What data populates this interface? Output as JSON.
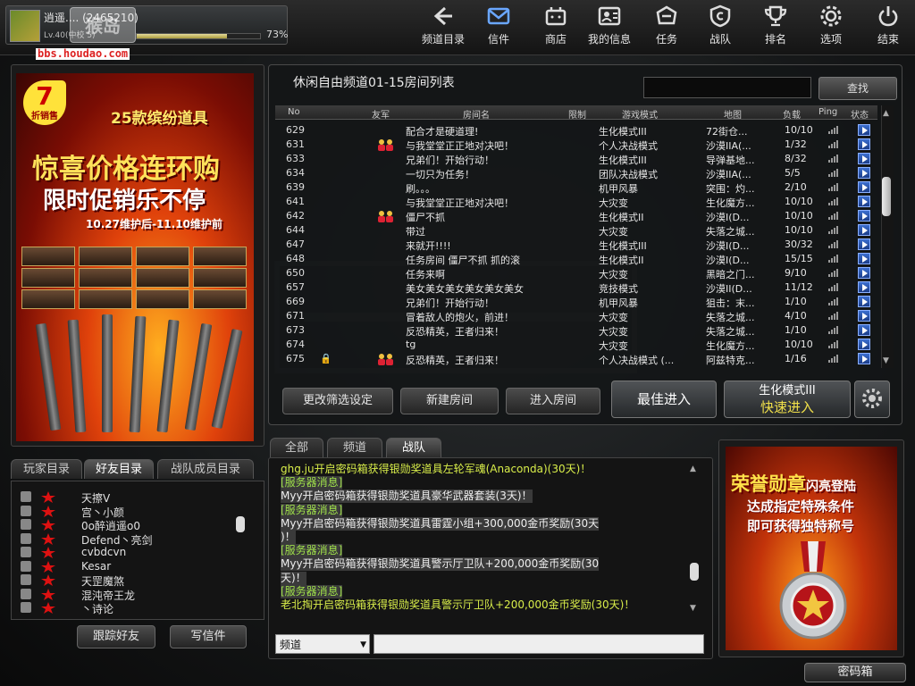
{
  "profile": {
    "name": "逍遥.... (2465210)",
    "level": "Lv.40(中校 5)",
    "xp_percent": "73%",
    "xp_fraction": 0.73
  },
  "watermark": {
    "url": "bbs.houdao.com",
    "logo": "猴岛"
  },
  "nav": [
    {
      "label": "频道目录",
      "icon": "back-arrow-icon"
    },
    {
      "label": "信件",
      "icon": "mail-icon"
    },
    {
      "label": "商店",
      "icon": "shop-icon"
    },
    {
      "label": "我的信息",
      "icon": "profile-card-icon"
    },
    {
      "label": "任务",
      "icon": "mission-icon"
    },
    {
      "label": "战队",
      "icon": "clan-shield-icon"
    },
    {
      "label": "排名",
      "icon": "trophy-icon"
    },
    {
      "label": "选项",
      "icon": "gear-icon"
    },
    {
      "label": "结束",
      "icon": "power-icon"
    }
  ],
  "ad_left": {
    "discount": "7",
    "discount_sub": "折销售",
    "line1": "25款缤纷道具",
    "line2": "惊喜价格连环购",
    "line3": "限时促销乐不停",
    "line4": "10.27维护后-11.10维护前"
  },
  "room_panel": {
    "title": "休闲自由频道01-15房间列表",
    "search_placeholder": "",
    "search_button": "查找",
    "columns": [
      "No",
      "友军",
      "房间名",
      "限制",
      "游戏模式",
      "地图",
      "负载",
      "Ping",
      "状态"
    ],
    "rows": [
      {
        "no": "629",
        "name": "配合才是硬道理!",
        "mode": "生化模式III",
        "map": "72街仓...",
        "load": "10/10",
        "friend": false,
        "lock": false
      },
      {
        "no": "631",
        "name": "与我堂堂正正地对决吧！",
        "mode": "个人决战模式",
        "map": "沙漠IIA(...",
        "load": "1/32",
        "friend": true,
        "lock": false
      },
      {
        "no": "633",
        "name": "兄弟们！开始行动！",
        "mode": "生化模式III",
        "map": "导弹基地...",
        "load": "8/32",
        "friend": false,
        "lock": false
      },
      {
        "no": "634",
        "name": "一切只为任务！",
        "mode": "团队决战模式",
        "map": "沙漠IIA(...",
        "load": "5/5",
        "friend": false,
        "lock": false
      },
      {
        "no": "639",
        "name": "刷。。。",
        "mode": "机甲风暴",
        "map": "突围：灼...",
        "load": "2/10",
        "friend": false,
        "lock": false
      },
      {
        "no": "641",
        "name": "与我堂堂正正地对决吧！",
        "mode": "大灾变",
        "map": "生化魔方...",
        "load": "10/10",
        "friend": false,
        "lock": false
      },
      {
        "no": "642",
        "name": "僵尸不抓",
        "mode": "生化模式II",
        "map": "沙漠I(D...",
        "load": "10/10",
        "friend": true,
        "lock": false
      },
      {
        "no": "644",
        "name": "带过",
        "mode": "大灾变",
        "map": "失落之城...",
        "load": "10/10",
        "friend": false,
        "lock": false
      },
      {
        "no": "647",
        "name": "来就开!!!!",
        "mode": "生化模式III",
        "map": "沙漠I(D...",
        "load": "30/32",
        "friend": false,
        "lock": false
      },
      {
        "no": "648",
        "name": "任务房间   僵尸不抓  抓的滚",
        "mode": "生化模式II",
        "map": "沙漠I(D...",
        "load": "15/15",
        "friend": false,
        "lock": false
      },
      {
        "no": "650",
        "name": "任务来啊",
        "mode": "大灾变",
        "map": "黑暗之门...",
        "load": "9/10",
        "friend": false,
        "lock": false
      },
      {
        "no": "657",
        "name": "美女美女美女美女美女美女",
        "mode": "竞技模式",
        "map": "沙漠II(D...",
        "load": "11/12",
        "friend": false,
        "lock": false
      },
      {
        "no": "669",
        "name": "兄弟们！开始行动！",
        "mode": "机甲风暴",
        "map": "狙击：末...",
        "load": "1/10",
        "friend": false,
        "lock": false
      },
      {
        "no": "671",
        "name": "冒着敌人的炮火，前进！",
        "mode": "大灾变",
        "map": "失落之城...",
        "load": "4/10",
        "friend": false,
        "lock": false
      },
      {
        "no": "673",
        "name": "反恐精英，王者归来！",
        "mode": "大灾变",
        "map": "失落之城...",
        "load": "1/10",
        "friend": false,
        "lock": false
      },
      {
        "no": "674",
        "name": "tg",
        "mode": "大灾变",
        "map": "生化魔方...",
        "load": "10/10",
        "friend": false,
        "lock": false
      },
      {
        "no": "675",
        "name": "反恐精英，王者归来！",
        "mode": "个人决战模式 (...",
        "map": "阿兹特克...",
        "load": "1/16",
        "friend": true,
        "lock": true
      }
    ],
    "buttons": {
      "filter": "更改筛选设定",
      "create": "新建房间",
      "enter": "进入房间",
      "best": "最佳进入",
      "quick_mode": "生化模式III",
      "quick": "快速进入"
    }
  },
  "friends": {
    "tabs": [
      "玩家目录",
      "好友目录",
      "战队成员目录"
    ],
    "active_tab": "好友目录",
    "list": [
      "天擦V",
      "宫丶小颜",
      "0o醉逍遥o0",
      "Defend丶亮剑",
      "cvbdcvn",
      "Kesar",
      "天罡魔煞",
      "混沌帝王龙",
      "丶诗论"
    ],
    "buttons": {
      "track": "跟踪好友",
      "mail": "写信件"
    }
  },
  "chat": {
    "tabs": [
      "全部",
      "频道",
      "战队"
    ],
    "active_tab": "战队",
    "lines": [
      {
        "text": "ghg.ju开启密码箱获得银勋奖道具左轮军魂(Anaconda)(30天)！",
        "kind": "g"
      },
      {
        "text": "[服务器消息]",
        "kind": "sys"
      },
      {
        "text": "Myy开启密码箱获得银勋奖道具豪华武器套装(3天)！",
        "kind": "w"
      },
      {
        "text": "[服务器消息]",
        "kind": "sys"
      },
      {
        "text": "Myy开启密码箱获得银勋奖道具雷霆小组+300,000金币奖励(30天",
        "kind": "w"
      },
      {
        "text": ")！",
        "kind": "w"
      },
      {
        "text": "[服务器消息]",
        "kind": "sys"
      },
      {
        "text": "Myy开启密码箱获得银勋奖道具警示厅卫队+200,000金币奖励(30",
        "kind": "w"
      },
      {
        "text": "天)！",
        "kind": "w"
      },
      {
        "text": "[服务器消息]",
        "kind": "sys"
      },
      {
        "text": "老北掏开启密码箱获得银勋奖道具警示厅卫队+200,000金币奖励(30天)！",
        "kind": "g"
      }
    ],
    "channel_select": "频道",
    "input_value": ""
  },
  "medal_ad": {
    "line1": "荣誉勋章",
    "line1b": "闪亮登陆",
    "line2": "达成指定特殊条件",
    "line3": "即可获得独特称号"
  },
  "password_box_button": "密码箱",
  "colors": {
    "accent_yellow": "#d9ee4a",
    "bg": "#141414",
    "ad_orange": "#e0420b"
  }
}
